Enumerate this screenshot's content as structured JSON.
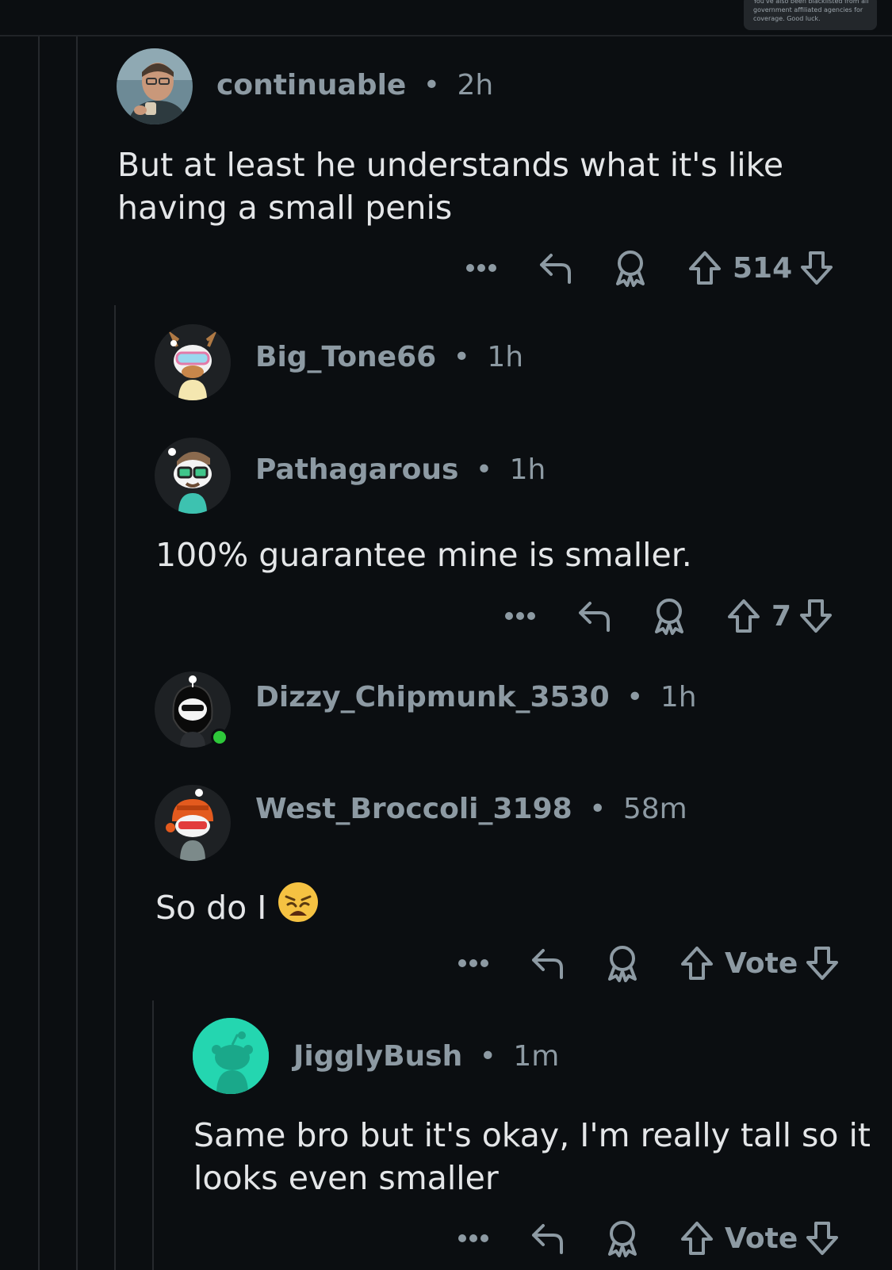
{
  "notification": {
    "text": "You've also been blacklisted from all government affiliated agencies for coverage. Good luck."
  },
  "separator": "•",
  "comments": [
    {
      "username": "continuable",
      "time": "2h",
      "body": "But at least he understands what it's like having a small penis",
      "body_line1": "But at least he understands what it's like",
      "body_line2": "having a small penis",
      "score": "514"
    },
    {
      "username": "Big_Tone66",
      "time": "1h"
    },
    {
      "username": "Pathagarous",
      "time": "1h",
      "body": "100% guarantee mine is smaller.",
      "score": "7"
    },
    {
      "username": "Dizzy_Chipmunk_3530",
      "time": "1h",
      "online": true
    },
    {
      "username": "West_Broccoli_3198",
      "time": "58m",
      "body": "So do I",
      "emoji": "weary-face",
      "score": "Vote"
    },
    {
      "username": "JigglyBush",
      "time": "1m",
      "body": "Same bro but it's okay, I'm really tall so it looks even smaller",
      "body_line1": "Same bro but it's okay, I'm really tall so it",
      "body_line2": "looks even smaller",
      "score": "Vote"
    }
  ],
  "icons": [
    "more-icon",
    "reply-icon",
    "award-icon",
    "upvote-icon",
    "downvote-icon"
  ],
  "colors": {
    "background": "#0b0e11",
    "meta": "#8d9aa3",
    "text": "#e4e6e8",
    "thread_line": "#26292d",
    "online": "#2ec83a",
    "default_avatar": "#24d6b0"
  }
}
